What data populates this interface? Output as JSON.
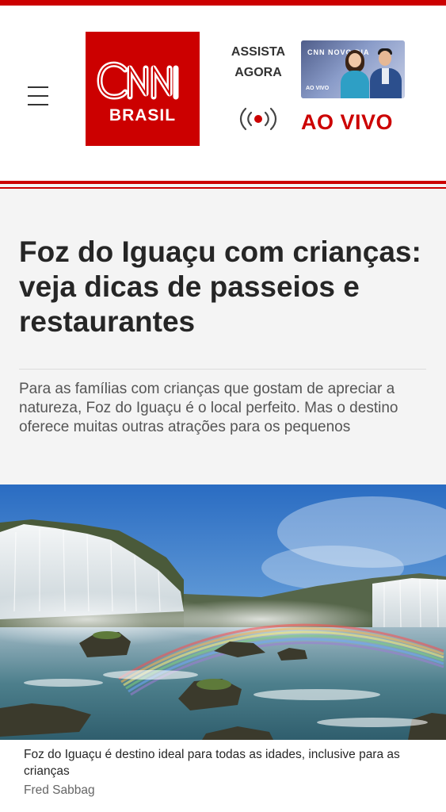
{
  "brand": {
    "logo_text": "CNN",
    "logo_subtitle": "BRASIL",
    "color": "#cc0000"
  },
  "header": {
    "menu_icon": "hamburger-menu-icon",
    "watch_now_line1": "ASSISTA",
    "watch_now_line2": "AGORA",
    "live_icon": "broadcast-live-icon",
    "live_label": "AO VIVO",
    "thumbnail": {
      "program": "CNN NOVO DIA",
      "tag": "AO VIVO"
    }
  },
  "article": {
    "headline": "Foz do Iguaçu com crianças: veja dicas de passeios e restaurantes",
    "dek": "Para as famílias com crianças que gostam de apreciar a natureza, Foz do Iguaçu é o local perfeito. Mas o destino oferece muitas outras atrações para os pequenos",
    "image": {
      "subject": "waterfalls-with-rainbow",
      "caption": "Foz do Iguaçu é destino ideal para todas as idades, inclusive para as crianças",
      "credit": "Fred Sabbag"
    }
  }
}
